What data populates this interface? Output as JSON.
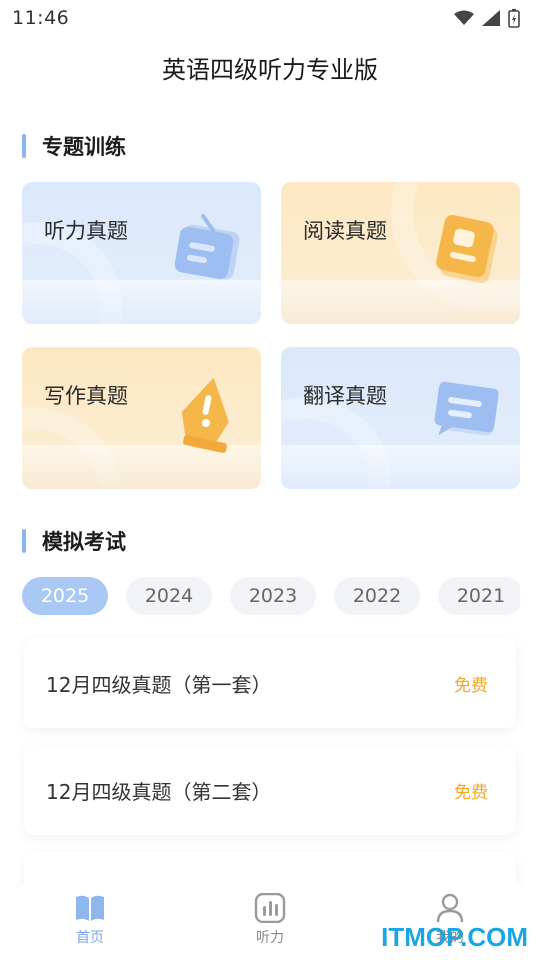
{
  "status": {
    "time": "11:46"
  },
  "app_title": "英语四级听力专业版",
  "section_topics": {
    "title": "专题训练"
  },
  "cards": [
    {
      "label": "听力真题",
      "icon": "radio-icon",
      "theme": "#dce9fb"
    },
    {
      "label": "阅读真题",
      "icon": "book-icon",
      "theme": "#fde8c2"
    },
    {
      "label": "写作真题",
      "icon": "pen-icon",
      "theme": "#fde8c2"
    },
    {
      "label": "翻译真题",
      "icon": "chat-icon",
      "theme": "#dce9fb"
    }
  ],
  "section_mock": {
    "title": "模拟考试"
  },
  "years": [
    "2025",
    "2024",
    "2023",
    "2022",
    "2021"
  ],
  "selected_year": "2025",
  "exams": [
    {
      "title": "12月四级真题（第一套）",
      "tag": "免费"
    },
    {
      "title": "12月四级真题（第二套）",
      "tag": "免费"
    }
  ],
  "tabs": [
    {
      "label": "首页",
      "icon": "book-open-icon",
      "active": true
    },
    {
      "label": "听力",
      "icon": "chart-icon",
      "active": false
    },
    {
      "label": "我的",
      "icon": "user-icon",
      "active": false
    }
  ],
  "watermark": "ITMOP.COM",
  "colors": {
    "accent": "#a9c8f3",
    "tag": "#f5a623",
    "blue_card": "#dce9fb",
    "orange_card": "#fde8c2"
  }
}
